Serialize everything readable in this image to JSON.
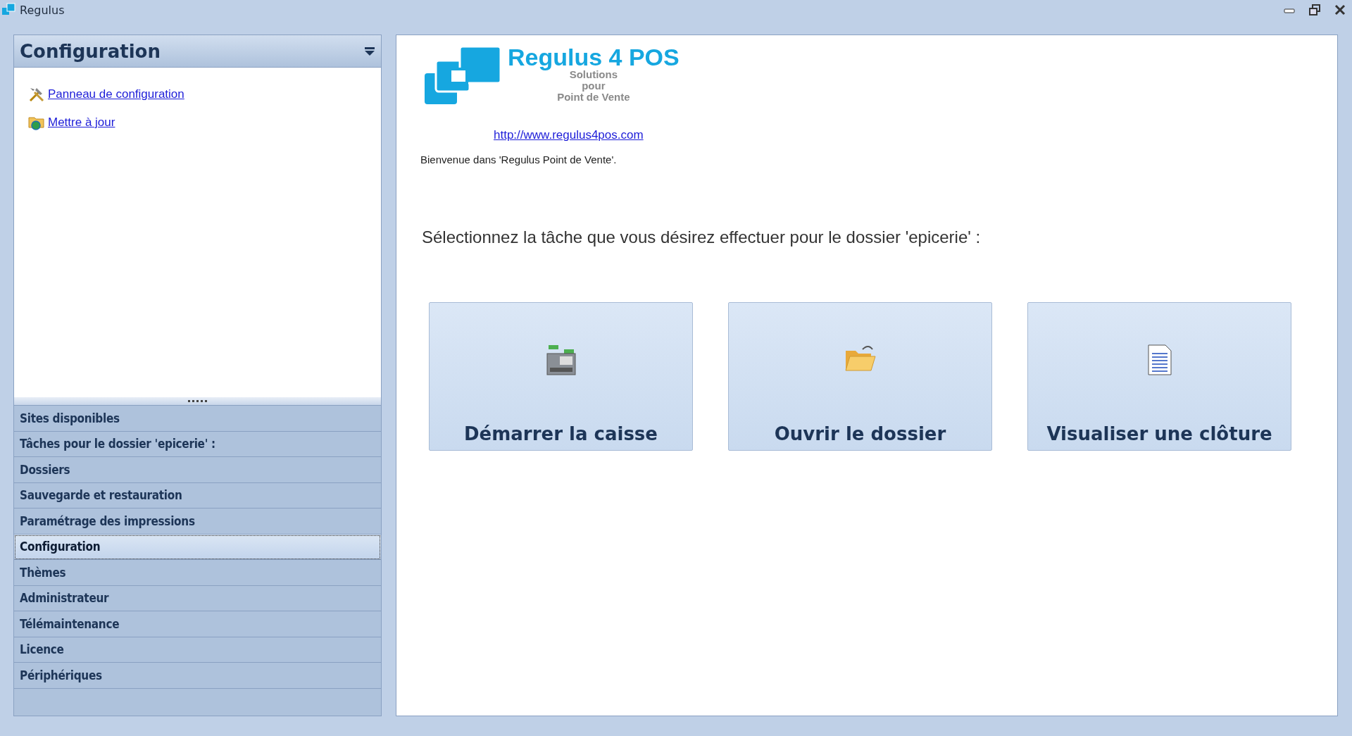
{
  "window": {
    "title": "Regulus"
  },
  "sidebar": {
    "header": "Configuration",
    "links": [
      {
        "kind": "tools",
        "label": "Panneau de configuration"
      },
      {
        "kind": "update",
        "label": "Mettre à jour"
      }
    ],
    "items": [
      {
        "label": "Sites disponibles",
        "selected": false
      },
      {
        "label": "Tâches pour le dossier 'epicerie' :",
        "selected": false
      },
      {
        "label": "Dossiers",
        "selected": false
      },
      {
        "label": "Sauvegarde et restauration",
        "selected": false
      },
      {
        "label": "Paramétrage des impressions",
        "selected": false
      },
      {
        "label": "Configuration",
        "selected": true
      },
      {
        "label": "Thèmes",
        "selected": false
      },
      {
        "label": "Administrateur",
        "selected": false
      },
      {
        "label": "Télémaintenance",
        "selected": false
      },
      {
        "label": "Licence",
        "selected": false
      },
      {
        "label": "Périphériques",
        "selected": false
      }
    ]
  },
  "main": {
    "logo": {
      "title": "Regulus 4 POS",
      "subtitle_lines": [
        "Solutions",
        "pour",
        "Point de Vente"
      ]
    },
    "url": "http://www.regulus4pos.com",
    "welcome": "Bienvenue dans 'Regulus Point de Vente'.",
    "prompt": "Sélectionnez la tâche que vous désirez effectuer pour le dossier 'epicerie' :",
    "tasks": [
      {
        "kind": "register",
        "label": "Démarrer la caisse"
      },
      {
        "kind": "folder",
        "label": "Ouvrir le dossier"
      },
      {
        "kind": "document",
        "label": "Visualiser une clôture"
      }
    ]
  }
}
